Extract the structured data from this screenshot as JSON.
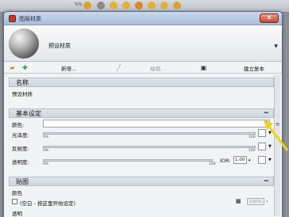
{
  "bg_toolbar": {
    "label": "%%"
  },
  "window": {
    "title": "图层材质",
    "close_symbol": "✕"
  },
  "header": {
    "preset_name": "预设材质"
  },
  "toolbar": {
    "new_label": "新增...",
    "edit_label": "编辑...",
    "create_copy_label": "建立复本"
  },
  "name_section": {
    "title": "名称",
    "value": "预设材质"
  },
  "basic_section": {
    "title": "基本设定",
    "collapse_symbol": "−",
    "color_label": "颜色:",
    "gloss_label": "光泽度:",
    "reflect_label": "反射度:",
    "transparency_label": "透明度:",
    "slider_min": "0%",
    "slider_max": "100",
    "ior_label": "IOR:",
    "ior_value": "1.00"
  },
  "texture_section": {
    "title": "贴图",
    "collapse_symbol": "−",
    "color_label": "颜色",
    "color_hint": "(空白 - 按这里开始设定)",
    "percent_value": "100%",
    "transparency_label": "透明"
  }
}
